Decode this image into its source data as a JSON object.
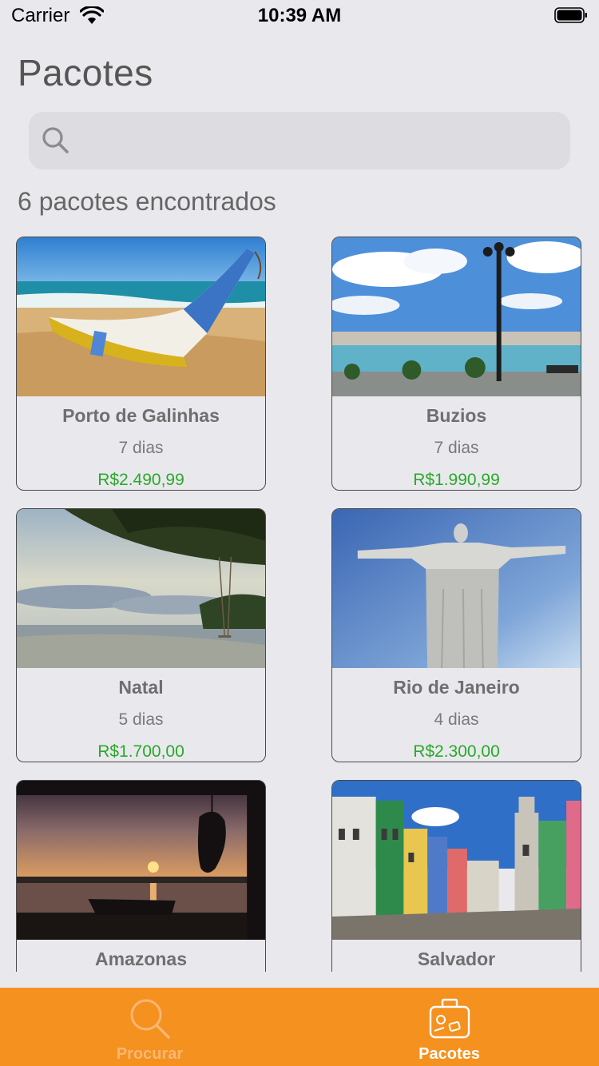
{
  "status_bar": {
    "carrier": "Carrier",
    "time": "10:39 AM"
  },
  "header": {
    "title": "Pacotes"
  },
  "search": {
    "placeholder": "",
    "value": ""
  },
  "results": {
    "count_label": "6 pacotes encontrados"
  },
  "packages": [
    {
      "name": "Porto de Galinhas",
      "duration": "7 dias",
      "price": "R$2.490,99"
    },
    {
      "name": "Buzios",
      "duration": "7 dias",
      "price": "R$1.990,99"
    },
    {
      "name": "Natal",
      "duration": "5 dias",
      "price": "R$1.700,00"
    },
    {
      "name": "Rio de Janeiro",
      "duration": "4 dias",
      "price": "R$2.300,00"
    },
    {
      "name": "Amazonas",
      "duration": "",
      "price": ""
    },
    {
      "name": "Salvador",
      "duration": "",
      "price": ""
    }
  ],
  "tab_bar": {
    "tabs": [
      {
        "label": "Procurar",
        "icon": "search-icon",
        "active": false
      },
      {
        "label": "Pacotes",
        "icon": "suitcase-icon",
        "active": true
      }
    ]
  },
  "colors": {
    "accent": "#f5911f",
    "price": "#2aa82a",
    "background": "#e9e9ed"
  }
}
